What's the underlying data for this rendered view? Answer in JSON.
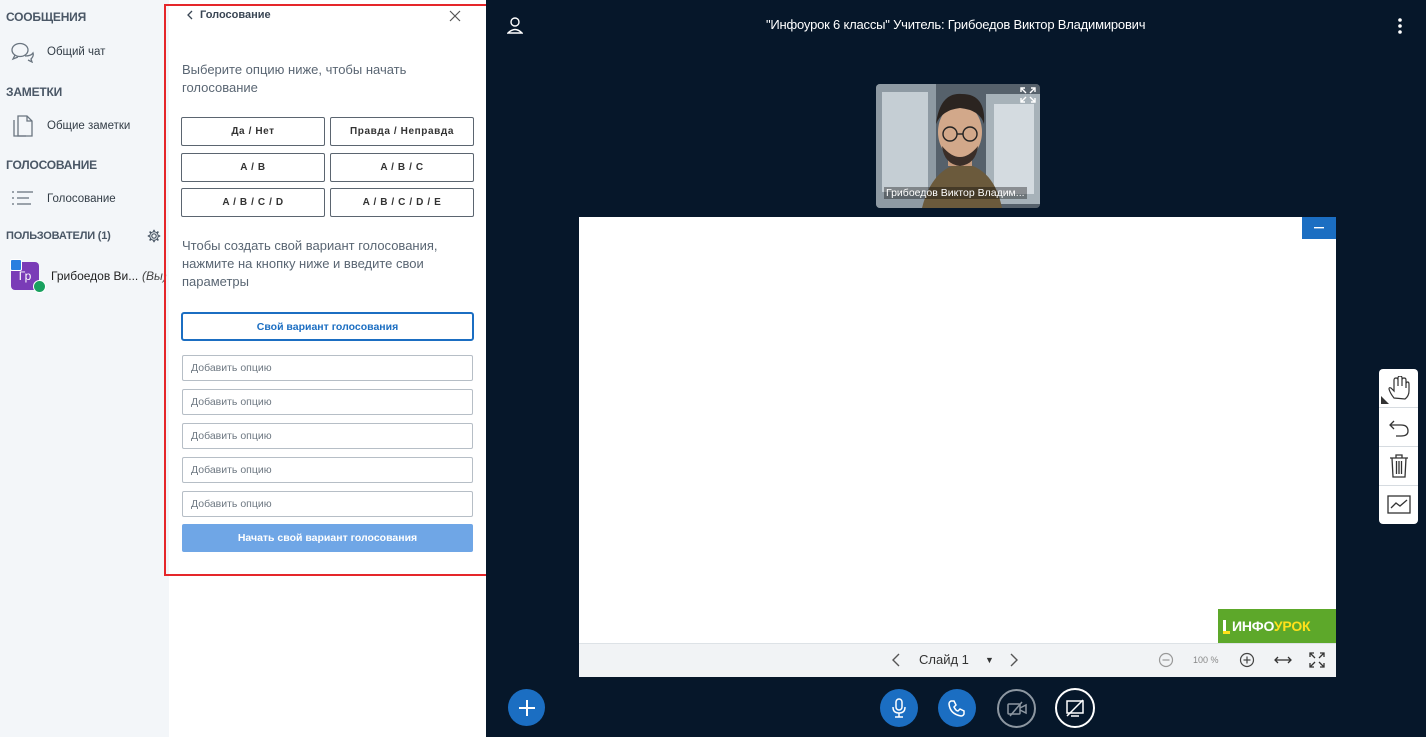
{
  "sidebar": {
    "messages_header": "СООБЩЕНИЯ",
    "public_chat": "Общий чат",
    "notes_header": "ЗАМЕТКИ",
    "shared_notes": "Общие заметки",
    "polling_header": "ГОЛОСОВАНИЕ",
    "polling_item": "Голосование",
    "users_header": "ПОЛЬЗОВАТЕЛИ (1)",
    "user": {
      "initials": "Гр",
      "name": "Грибоедов Ви...",
      "you_label": "(Вы)"
    }
  },
  "poll": {
    "back_label": "Голосование",
    "intro": "Выберите опцию ниже, чтобы начать голосование",
    "quick_options": [
      "Да / Нет",
      "Правда / Неправда",
      "A / B",
      "A / B / C",
      "A / B / C / D",
      "A / B / C / D / E"
    ],
    "custom_hint": "Чтобы создать свой вариант голосования, нажмите на кнопку ниже и введите свои параметры",
    "custom_button": "Свой вариант голосования",
    "option_placeholder": "Добавить опцию",
    "start_button": "Начать свой вариант голосования"
  },
  "header": {
    "title": "\"Инфоурок 6 классы\" Учитель: Грибоедов Виктор Владимирович"
  },
  "video": {
    "name": "Грибоедов Виктор Владим..."
  },
  "presentation": {
    "logo_part1": "ИНФО",
    "logo_part2": "УРОК",
    "slide_label": "Слайд 1",
    "zoom": "100 %"
  },
  "colors": {
    "accent": "#1b6ec2",
    "background": "#06172a",
    "highlight": "#e5262a",
    "logo_bg": "#5da82a"
  }
}
